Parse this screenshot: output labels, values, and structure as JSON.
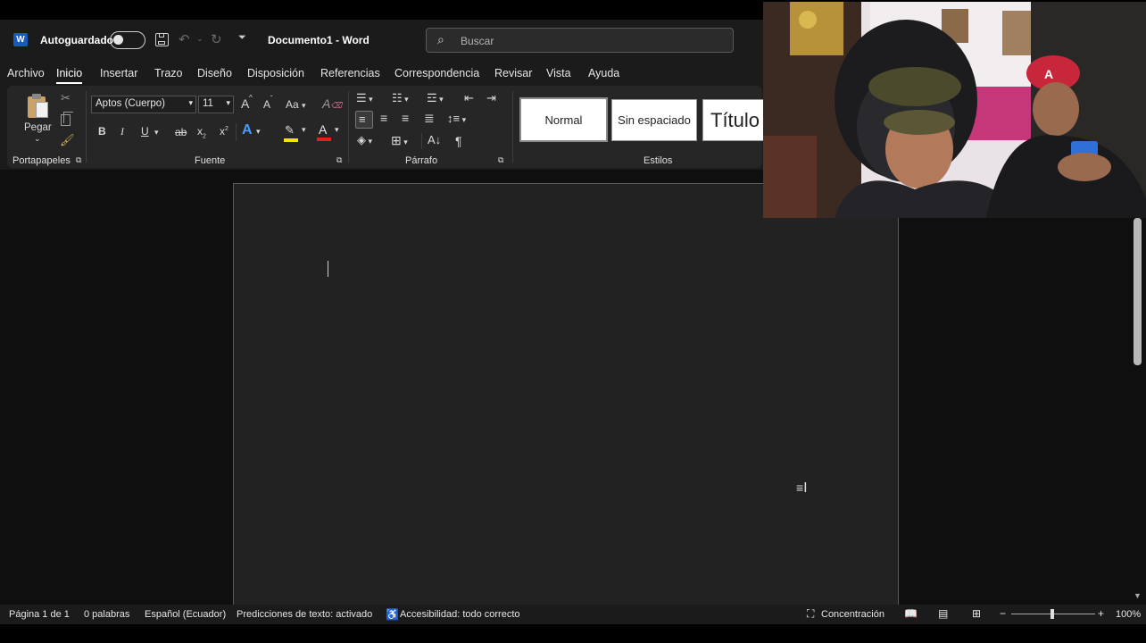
{
  "titlebar": {
    "autosave_label": "Autoguardado",
    "doc_title": "Documento1  -  Word",
    "search_placeholder": "Buscar"
  },
  "tabs": [
    {
      "label": "Archivo"
    },
    {
      "label": "Inicio",
      "active": true
    },
    {
      "label": "Insertar"
    },
    {
      "label": "Trazo"
    },
    {
      "label": "Diseño"
    },
    {
      "label": "Disposición"
    },
    {
      "label": "Referencias"
    },
    {
      "label": "Correspondencia"
    },
    {
      "label": "Revisar"
    },
    {
      "label": "Vista"
    },
    {
      "label": "Ayuda"
    }
  ],
  "ribbon": {
    "clipboard": {
      "paste_label": "Pegar",
      "group_label": "Portapapeles"
    },
    "font": {
      "font_name": "Aptos (Cuerpo)",
      "font_size": "11",
      "group_label": "Fuente",
      "bold": "B",
      "italic": "I",
      "underline": "U",
      "strike": "ab",
      "change_case": "Aa",
      "grow": "A",
      "shrink": "A",
      "text_effects": "A",
      "font_color": "A"
    },
    "paragraph": {
      "group_label": "Párrafo",
      "pilcrow": "¶"
    },
    "styles": {
      "group_label": "Estilos",
      "items": [
        "Normal",
        "Sin espaciado",
        "Título"
      ]
    }
  },
  "status": {
    "page": "Página 1 de 1",
    "words": "0 palabras",
    "language": "Español (Ecuador)",
    "predictions": "Predicciones de texto: activado",
    "accessibility": "Accesibilidad: todo correcto",
    "focus": "Concentración",
    "zoom": "100%"
  },
  "colors": {
    "accent_word": "#185abd",
    "highlight_yellow": "#f5e500",
    "font_red": "#e02020",
    "text_effect_blue": "#4a9bff"
  }
}
